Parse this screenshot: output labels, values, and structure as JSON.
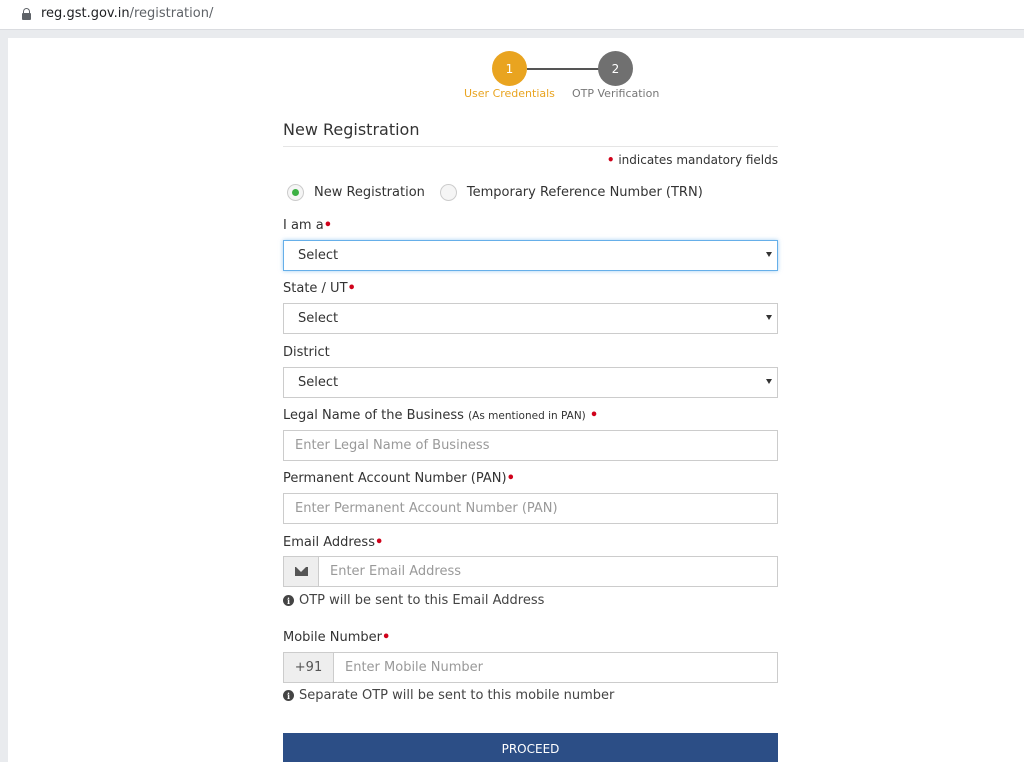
{
  "browser": {
    "url_host": "reg.gst.gov.in",
    "url_path": "/registration/"
  },
  "stepper": {
    "steps": [
      {
        "number": "1",
        "label": "User Credentials"
      },
      {
        "number": "2",
        "label": "OTP Verification"
      }
    ],
    "active_color": "#e9a420",
    "inactive_color": "#707070"
  },
  "form": {
    "title": "New Registration",
    "mandatory_note": "indicates mandatory fields",
    "required_marker": "•",
    "radio_options": [
      {
        "label": "New Registration",
        "checked": true
      },
      {
        "label": "Temporary Reference Number (TRN)",
        "checked": false
      }
    ],
    "i_am_a": {
      "label": "I am a",
      "value": "Select"
    },
    "state": {
      "label": "State / UT",
      "value": "Select"
    },
    "district": {
      "label": "District",
      "value": "Select"
    },
    "legal_name": {
      "label": "Legal Name of the Business",
      "label_note": "(As mentioned in PAN)",
      "placeholder": "Enter Legal Name of Business"
    },
    "pan": {
      "label": "Permanent Account Number (PAN)",
      "placeholder": "Enter Permanent Account Number (PAN)"
    },
    "email": {
      "label": "Email Address",
      "placeholder": "Enter Email Address",
      "hint": "OTP will be sent to this Email Address",
      "addon_icon": "envelope-icon"
    },
    "mobile": {
      "label": "Mobile Number",
      "prefix": "+91",
      "placeholder": "Enter Mobile Number",
      "hint": "Separate OTP will be sent to this mobile number"
    },
    "info_glyph": "i",
    "proceed_label": "PROCEED",
    "proceed_color": "#2c4e86"
  }
}
